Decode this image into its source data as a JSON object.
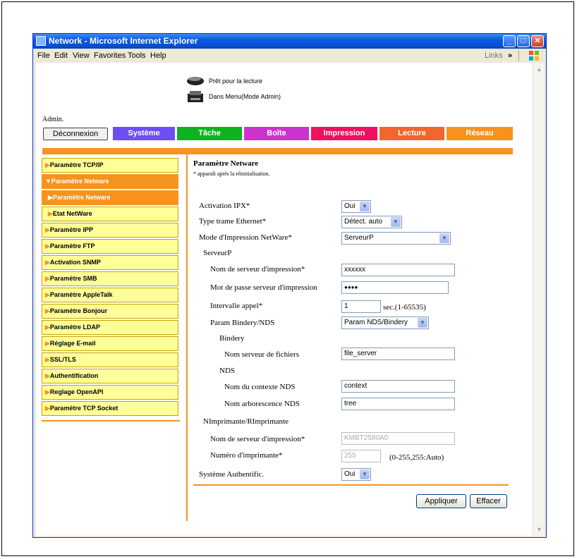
{
  "window": {
    "title": "Network - Microsoft Internet Explorer"
  },
  "menu": {
    "items": [
      "File",
      "Edit",
      "View",
      "Favorites",
      "Tools",
      "Help"
    ],
    "links": "Links"
  },
  "status": {
    "line1": "Prêt pour la lecture",
    "line2": "Dans Menu(Mode Admin)"
  },
  "admin_label": "Admin.",
  "logout_label": "Déconnexion",
  "tabs": [
    {
      "label": "Système",
      "color": "#6B4FF2"
    },
    {
      "label": "Tâche",
      "color": "#0EB31F"
    },
    {
      "label": "Boîte",
      "color": "#CC33CC"
    },
    {
      "label": "Impression",
      "color": "#F0105F"
    },
    {
      "label": "Lecture",
      "color": "#F2662E"
    },
    {
      "label": "Réseau",
      "color": "#F7931D"
    }
  ],
  "sidebar": {
    "items": [
      {
        "label": "Paramètre TCP/IP"
      },
      {
        "label": "Paramètre Netware"
      },
      {
        "label": "Paramètre Netware"
      },
      {
        "label": "Etat NetWare"
      },
      {
        "label": "Paramètre IPP"
      },
      {
        "label": "Paramètre FTP"
      },
      {
        "label": "Activation SNMP"
      },
      {
        "label": "Paramètre SMB"
      },
      {
        "label": "Paramètre AppleTalk"
      },
      {
        "label": "Paramètre Bonjour"
      },
      {
        "label": "Paramètre LDAP"
      },
      {
        "label": "Réglage E-mail"
      },
      {
        "label": "SSL/TLS"
      },
      {
        "label": "Authentification"
      },
      {
        "label": "Reglage OpenAPI"
      },
      {
        "label": "Paramètre TCP Socket"
      }
    ]
  },
  "form": {
    "title": "Paramètre Netware",
    "note": "* apparaît après la réinitialisation.",
    "ipx_label": "Activation IPX*",
    "ipx_value": "Oui",
    "frame_label": "Type trame Ethernet*",
    "frame_value": "Détect. auto",
    "mode_label": "Mode d'Impression NetWare*",
    "mode_value": "ServeurP",
    "serveurp_label": "ServeurP",
    "ps_name_label": "Nom de serveur d'impression*",
    "ps_name_value": "xxxxxx",
    "ps_pass_label": "Mot de passe serveur d'impression",
    "ps_pass_value": "●●●●",
    "poll_label": "Intervalle appel*",
    "poll_value": "1",
    "poll_unit": "sec.(1-65535)",
    "bindery_label": "Param Bindery/NDS",
    "bindery_value": "Param NDS/Bindery",
    "bindery_section": "Bindery",
    "fileserver_label": "Nom serveur de fichiers",
    "fileserver_value": "file_server",
    "nds_section": "NDS",
    "context_label": "Nom du contexte NDS",
    "context_value": "context",
    "tree_label": "Nom arborescence NDS",
    "tree_value": "tree",
    "nprinter_section": "NImprimante/RImprimante",
    "np_server_label": "Nom de serveur d'impression*",
    "np_server_value": "KMBT2580A0",
    "printer_num_label": "Numéro d'imprimante*",
    "printer_num_value": "255",
    "printer_num_range": "(0-255,255:Auto)",
    "auth_label": "Système Authentific.",
    "auth_value": "Oui",
    "apply_label": "Appliquer",
    "clear_label": "Effacer"
  }
}
